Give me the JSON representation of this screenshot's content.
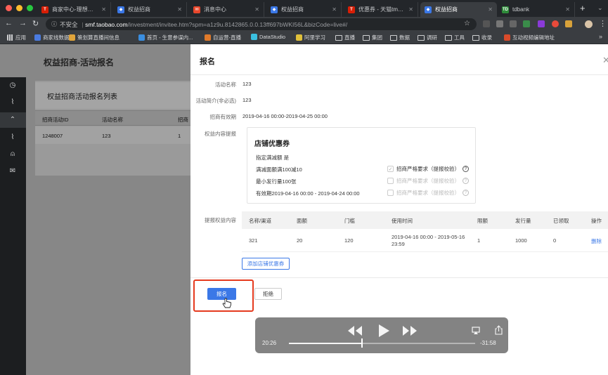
{
  "browser": {
    "tabs": [
      {
        "label": "商家中心-理想生活上...",
        "icon": "tmall-icon",
        "color": "#d81e06",
        "glyph": "T"
      },
      {
        "label": "权益招商",
        "icon": "taobao-icon",
        "color": "#3b78e7",
        "glyph": "◆"
      },
      {
        "label": "消息中心",
        "icon": "message-icon",
        "color": "#e8472c",
        "glyph": "✉"
      },
      {
        "label": "权益招商",
        "icon": "taobao-icon",
        "color": "#3b78e7",
        "glyph": "◆"
      },
      {
        "label": "优惠券 - 天猫tmall.c...",
        "icon": "tmall-icon",
        "color": "#d81e06",
        "glyph": "T"
      },
      {
        "label": "权益招商",
        "icon": "taobao-icon",
        "color": "#3b78e7",
        "glyph": "◆"
      },
      {
        "label": "tdbank",
        "icon": "tdbank-icon",
        "color": "#2e8b3a",
        "glyph": "TD"
      }
    ],
    "address": {
      "security": "不安全",
      "host": "smf.taobao.com",
      "path": "/investment/invitee.htm?spm=a1z9u.8142865.0.0.13ff697bWKI56L&bizCode=live#/"
    },
    "bookmarks": [
      {
        "label": "应用",
        "kind": "grid"
      },
      {
        "label": "商家线数据",
        "kind": "icon",
        "color": "#4a7be0"
      },
      {
        "label": "策划算直播间信息",
        "kind": "icon",
        "color": "#e0a43a"
      },
      {
        "label": "首页 - 生意参谋内...",
        "kind": "icon",
        "color": "#3a8ee0"
      },
      {
        "label": "自运营-直播",
        "kind": "icon",
        "color": "#e07a2a"
      },
      {
        "label": "DataStudio",
        "kind": "icon",
        "color": "#3ac0e0"
      },
      {
        "label": "阿里学习",
        "kind": "icon",
        "color": "#e0c03a"
      },
      {
        "label": "直播",
        "kind": "folder"
      },
      {
        "label": "集团",
        "kind": "folder"
      },
      {
        "label": "数据",
        "kind": "folder"
      },
      {
        "label": "调研",
        "kind": "folder"
      },
      {
        "label": "工具",
        "kind": "folder"
      },
      {
        "label": "收录",
        "kind": "folder"
      },
      {
        "label": "互动视频编辑地址",
        "kind": "icon",
        "color": "#d84a2a"
      }
    ]
  },
  "page": {
    "title": "权益招商-活动报名",
    "list": {
      "title": "权益招商活动报名列表",
      "columns": [
        "招商活动ID",
        "活动名称",
        "招商"
      ],
      "row": [
        "1248007",
        "123",
        "1"
      ]
    }
  },
  "drawer": {
    "title": "报名",
    "fields": {
      "name_label": "活动名称",
      "name_value": "123",
      "intro_label": "活动简介(非必选)",
      "intro_value": "123",
      "period_label": "招商有效期",
      "period_value": "2019-04-16 00:00-2019-04-25 00:00",
      "content_label": "权益内容提报",
      "submit_label": "提报权益内容"
    },
    "coupon": {
      "title": "店铺优惠券",
      "threshold_label": "指定满减额  是",
      "rule": "满减面额满100减10",
      "min_issue": "最小发行量100张",
      "validity": "有效期2019-04-16 00:00 - 2019-04-24 00:00",
      "checks": [
        {
          "label": "招商严格要求（提报校验）",
          "checked": true,
          "disabled": false
        },
        {
          "label": "招商严格要求（提报校验）",
          "checked": false,
          "disabled": true
        },
        {
          "label": "招商严格要求（提报校验）",
          "checked": false,
          "disabled": true
        }
      ]
    },
    "table": {
      "columns": [
        "名称/渠道",
        "面额",
        "门槛",
        "使用时间",
        "限额",
        "发行量",
        "已领取",
        "操作"
      ],
      "row": {
        "name": "321",
        "denom": "20",
        "threshold": "120",
        "time_line1": "2019-04-16 00:00 - 2019-05-16",
        "time_line2": "23:59",
        "limit": "1",
        "issued": "1000",
        "claimed": "0",
        "action": "删除"
      }
    },
    "add_coupon_label": "添加店铺优惠券",
    "submit_button": "报名",
    "reject_button": "拒绝"
  },
  "video": {
    "elapsed": "20:26",
    "remaining": "-31:58",
    "progress": 0.39
  },
  "colors": {
    "accent": "#3b78e7",
    "highlight": "#e53a1e"
  }
}
